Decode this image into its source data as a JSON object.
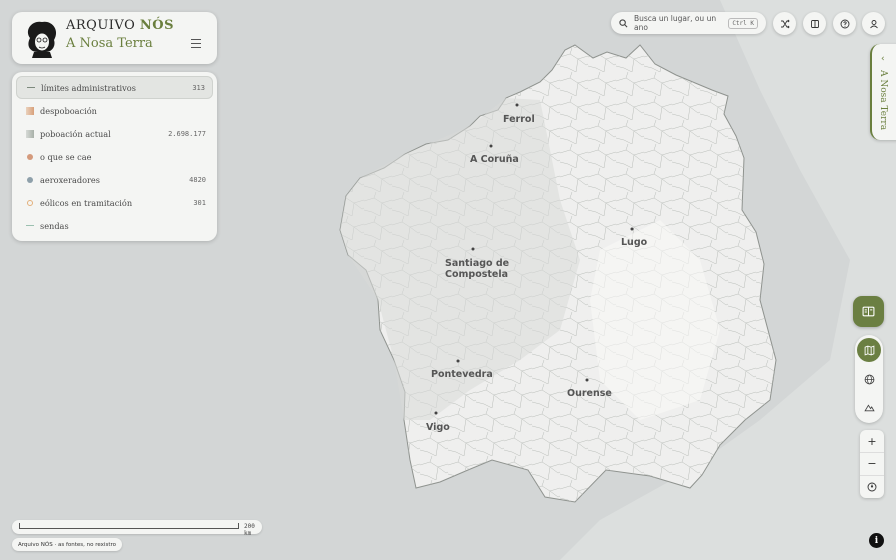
{
  "brand": {
    "title_a": "ARQUIVO ",
    "title_b": "NÓS",
    "subtitle": "A Nosa Terra"
  },
  "layers": [
    {
      "label": "límites administrativos",
      "count": "313",
      "swatch": "line",
      "color": "#7d8a7d",
      "active": true
    },
    {
      "label": "despoboación",
      "count": "",
      "swatch": "gradient",
      "color": "#d8a07a"
    },
    {
      "label": "poboación actual",
      "count": "2.698.177",
      "swatch": "gradient",
      "color": "#a8b0a8"
    },
    {
      "label": "o que se cae",
      "count": "",
      "swatch": "dot",
      "color": "#d49a7c"
    },
    {
      "label": "aeroxeradores",
      "count": "4820",
      "swatch": "dot",
      "color": "#8ea0aa"
    },
    {
      "label": "eólicos en tramitación",
      "count": "301",
      "swatch": "ring",
      "color": "#e3b07a"
    },
    {
      "label": "sendas",
      "count": "",
      "swatch": "line",
      "color": "#9bc0b0"
    }
  ],
  "search": {
    "placeholder": "Busca un lugar, ou un ano",
    "shortcut": "Ctrl K"
  },
  "sidetab": {
    "label": "A Nosa Terra"
  },
  "cities": [
    {
      "name": "Ferrol"
    },
    {
      "name": "A Coruña"
    },
    {
      "name": "Lugo"
    },
    {
      "name": "Santiago de"
    },
    {
      "name": "Compostela"
    },
    {
      "name": "Pontevedra"
    },
    {
      "name": "Ourense"
    },
    {
      "name": "Vigo"
    }
  ],
  "zoom": {
    "in": "+",
    "out": "−"
  },
  "scale": {
    "label": "200 km"
  },
  "attribution": "Arquivo NÓS · as fontes, no rexistro",
  "info": "i",
  "icons": {
    "search": "search-icon",
    "shuffle": "shuffle-icon",
    "book": "book-icon",
    "help": "help-icon",
    "user": "user-icon"
  }
}
